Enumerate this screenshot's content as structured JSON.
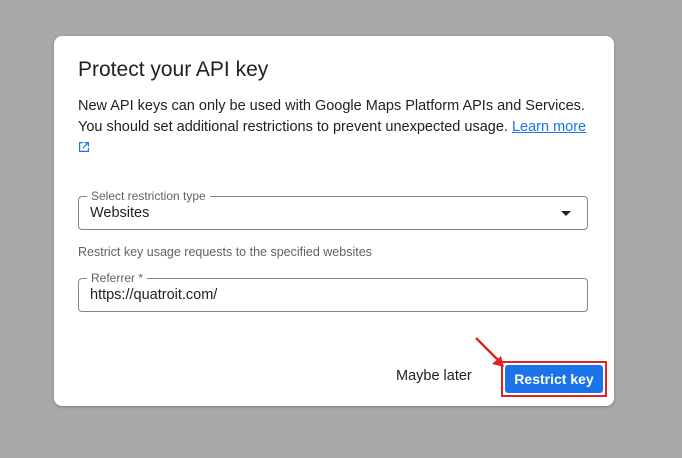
{
  "dialog": {
    "title": "Protect your API key",
    "description": "New API keys can only be used with Google Maps Platform APIs and Services. You should set additional restrictions to prevent unexpected usage.",
    "learn_more": "Learn more",
    "restriction": {
      "label": "Select restriction type",
      "value": "Websites"
    },
    "helper_text": "Restrict key usage requests to the specified websites",
    "referrer": {
      "label": "Referrer *",
      "value": "https://quatroit.com/"
    },
    "buttons": {
      "later": "Maybe later",
      "restrict": "Restrict key"
    }
  },
  "colors": {
    "accent": "#1a73e8",
    "annotation": "#e02424"
  },
  "icons": {
    "external_link": "external-link-icon",
    "dropdown": "dropdown-arrow-icon",
    "annotation_arrow": "annotation-arrow-icon"
  }
}
